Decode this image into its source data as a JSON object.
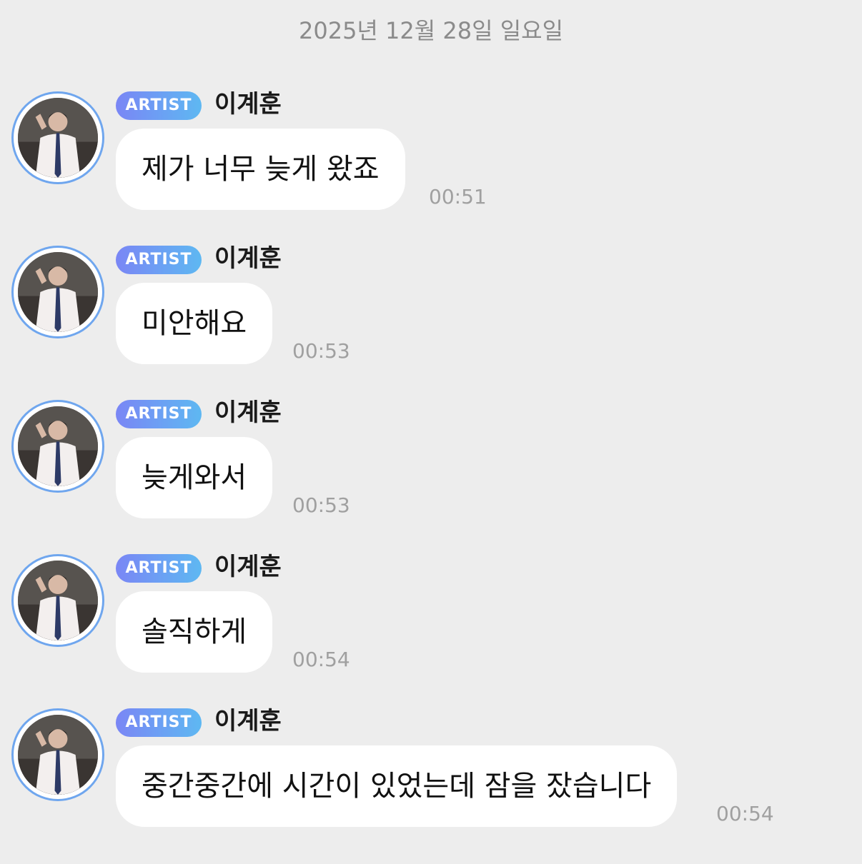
{
  "date_header": "2025년 12월 28일 일요일",
  "sender": {
    "badge": "ARTIST",
    "name": "이계훈",
    "avatar_icon": "profile-photo-avatar"
  },
  "colors": {
    "background": "#ededed",
    "bubble": "#ffffff",
    "badge_gradient_start": "#7a86f5",
    "badge_gradient_end": "#5eb8f2",
    "avatar_ring": "#6fa6ee",
    "timestamp": "#a0a0a0"
  },
  "messages": [
    {
      "text": "제가 너무 늦게 왔죠",
      "time": "00:51"
    },
    {
      "text": "미안해요",
      "time": "00:53"
    },
    {
      "text": "늦게와서",
      "time": "00:53"
    },
    {
      "text": "솔직하게",
      "time": "00:54"
    },
    {
      "text": "중간중간에 시간이 있었는데 잠을 잤습니다",
      "time": "00:54"
    }
  ]
}
